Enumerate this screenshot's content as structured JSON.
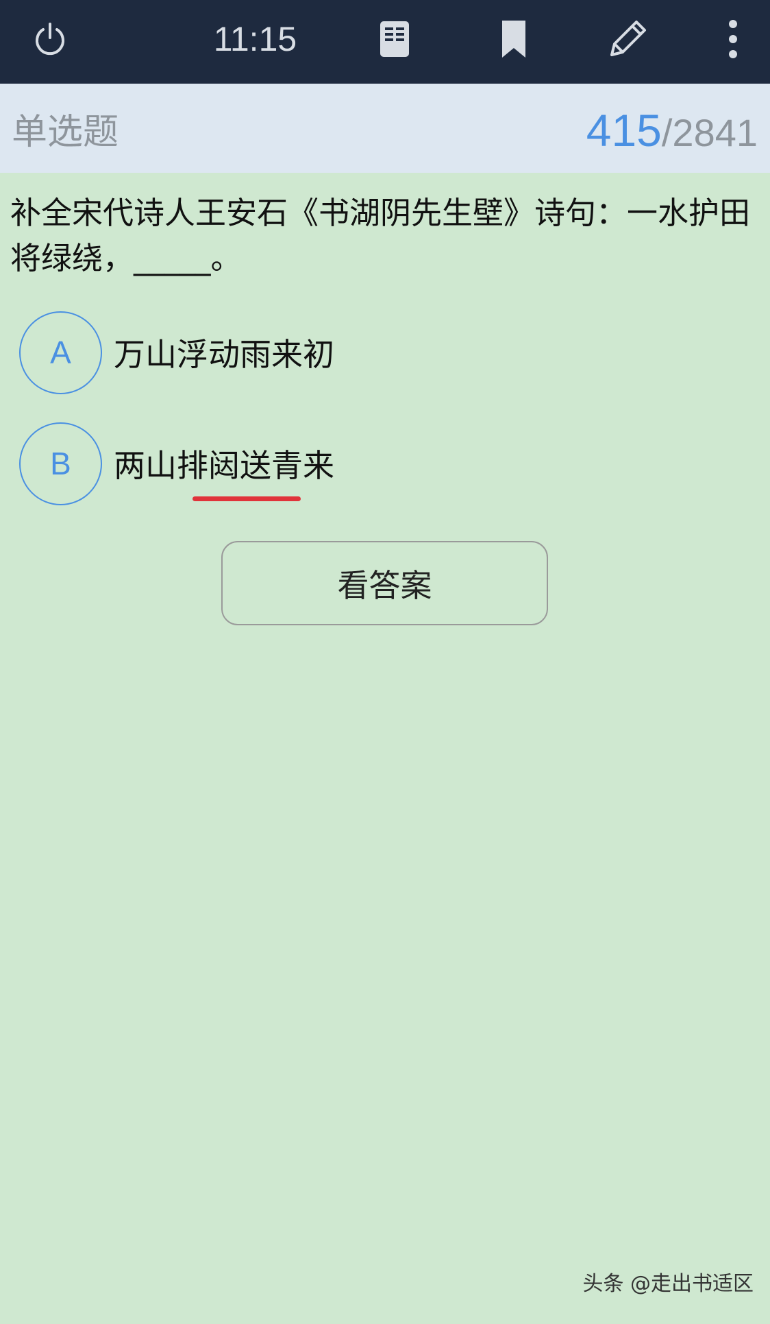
{
  "status_bar": {
    "time": "11:15",
    "icons": [
      "power-icon",
      "book-icon",
      "bookmark-icon",
      "pencil-icon",
      "more-vertical-icon"
    ]
  },
  "header": {
    "question_type": "单选题",
    "current": "415",
    "separator": "/",
    "total": "2841"
  },
  "question": {
    "text": "补全宋代诗人王安石《书湖阴先生壁》诗句：一水护田将绿绕，_____。"
  },
  "options": [
    {
      "letter": "A",
      "text": "万山浮动雨来初"
    },
    {
      "letter": "B",
      "text": "两山排闼送青来"
    }
  ],
  "answer_button": {
    "label": "看答案"
  },
  "watermark": "头条 @走出书适区",
  "colors": {
    "topbar": "#1e2a3f",
    "header": "#dde7f1",
    "background": "#cfe8d0",
    "accent": "#4a90e2",
    "underline": "#e0333a"
  }
}
